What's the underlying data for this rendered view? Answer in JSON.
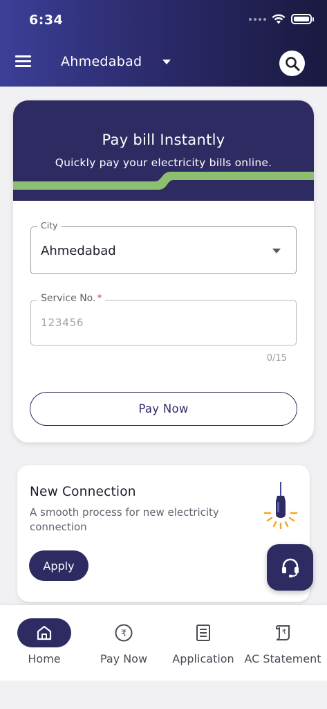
{
  "status_bar": {
    "time": "6:34"
  },
  "header": {
    "selected_city": "Ahmedabad",
    "menu_icon": "hamburger-menu-icon",
    "search_icon": "search-icon"
  },
  "pay_card": {
    "title": "Pay bill Instantly",
    "subtitle": "Quickly pay your electricity bills online.",
    "city_field": {
      "label": "City",
      "value": "Ahmedabad"
    },
    "service_field": {
      "label": "Service No.",
      "required_mark": "*",
      "placeholder": "123456",
      "counter": "0/15"
    },
    "pay_button": "Pay Now",
    "colors": {
      "banner": "#2d2b62",
      "wave": "#8cbf6f"
    }
  },
  "new_connection": {
    "title": "New Connection",
    "description": "A smooth process for new electricity connection",
    "apply_button": "Apply",
    "icon": "light-bulb-icon"
  },
  "support": {
    "icon": "headset-icon"
  },
  "bottom_nav": {
    "items": [
      {
        "label": "Home",
        "icon": "home-icon",
        "active": true
      },
      {
        "label": "Pay Now",
        "icon": "rupee-icon",
        "active": false
      },
      {
        "label": "Application",
        "icon": "document-icon",
        "active": false
      },
      {
        "label": "AC Statement",
        "icon": "statement-icon",
        "active": false
      }
    ]
  },
  "theme": {
    "primary": "#2d2b62",
    "header_gradient_start": "#3b3f97",
    "header_gradient_end": "#1a1940"
  }
}
